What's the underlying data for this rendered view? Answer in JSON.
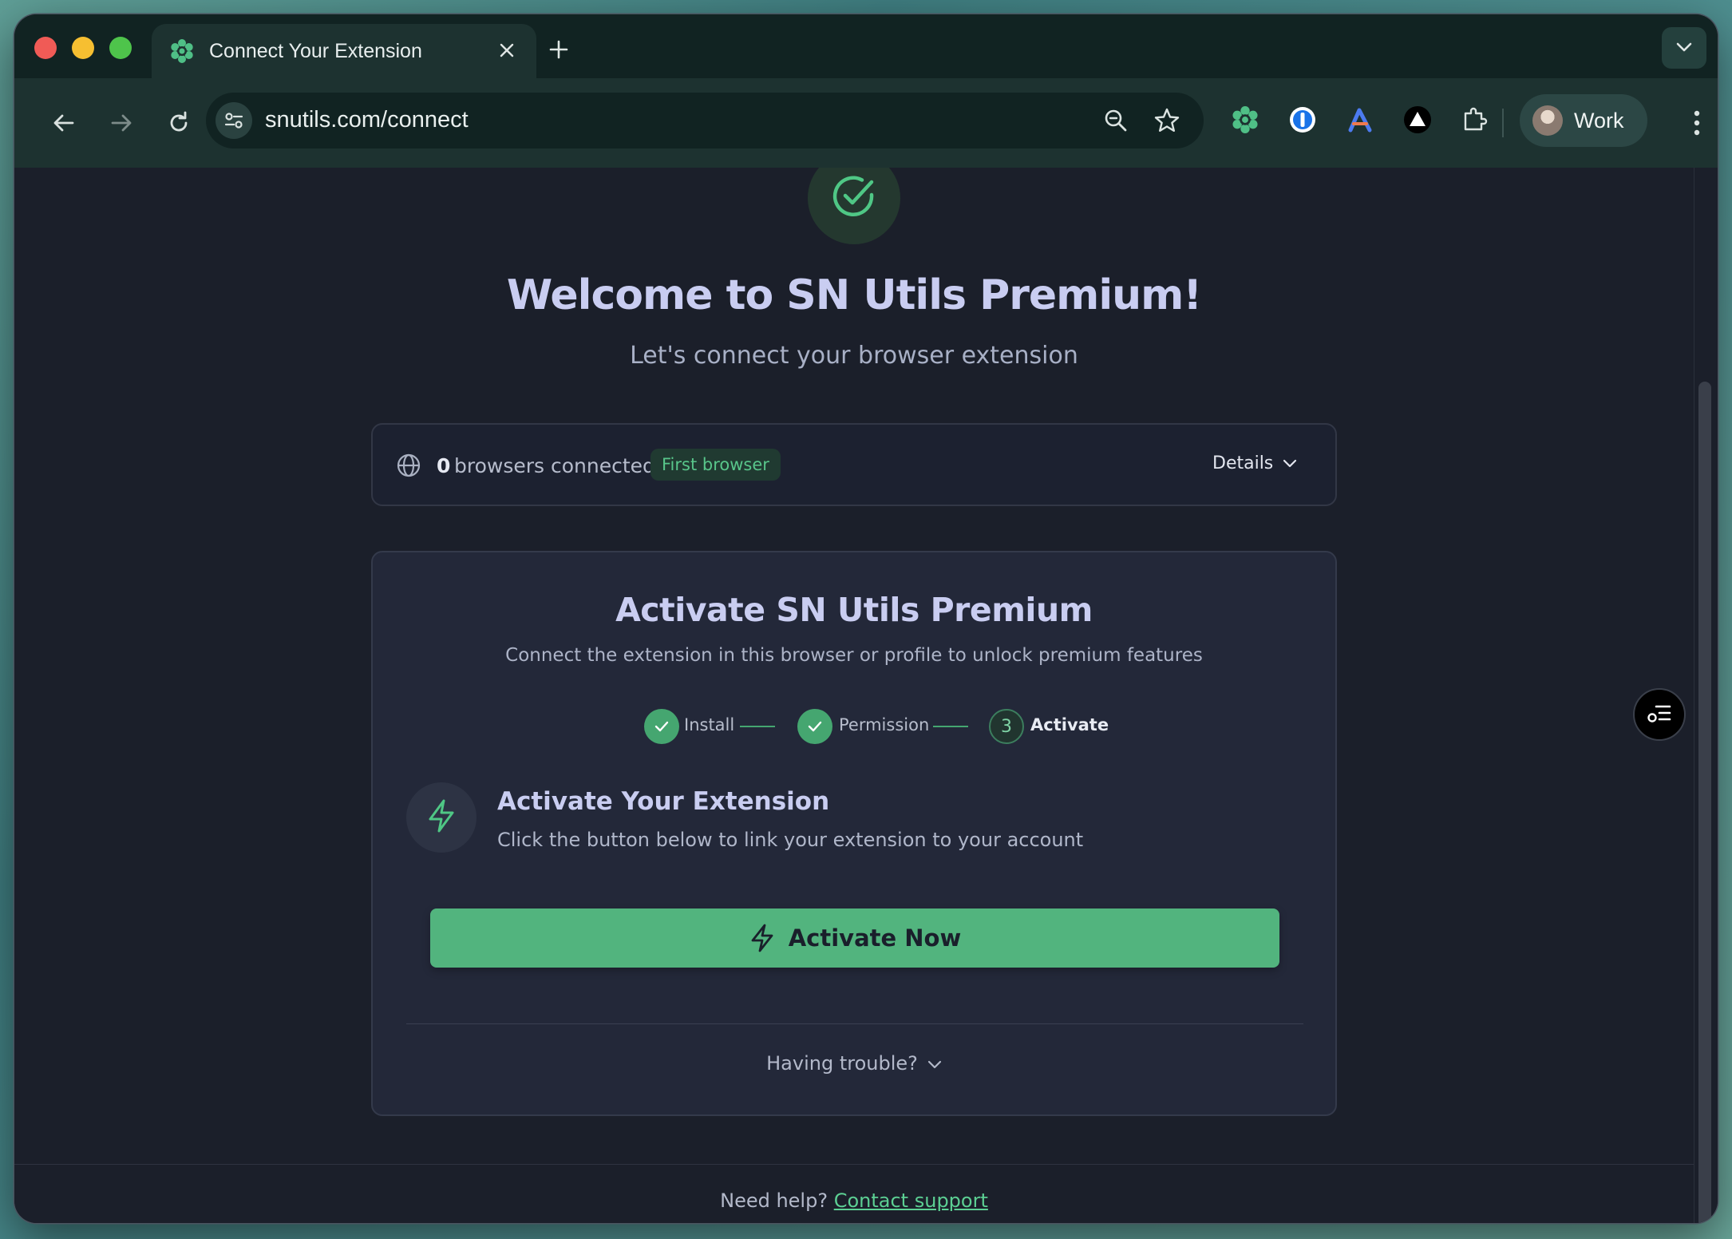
{
  "browser": {
    "tab": {
      "title": "Connect Your Extension",
      "favicon": "gear-flower-icon"
    },
    "url": "snutils.com/connect",
    "profile": {
      "name": "Work"
    },
    "toolbar_icons": [
      "back-arrow-icon",
      "forward-arrow-icon",
      "reload-icon",
      "site-settings-icon",
      "zoom-icon",
      "bookmark-star-icon",
      "sn-utils-extension-icon",
      "onepassword-icon",
      "arc-a-icon",
      "vercel-triangle-icon",
      "extensions-puzzle-icon",
      "kebab-menu-icon"
    ]
  },
  "hero": {
    "title": "Welcome to SN Utils Premium!",
    "subtitle": "Let's connect your browser extension"
  },
  "browsers": {
    "count": "0",
    "label": "browsers connected",
    "badge": "First browser",
    "details_label": "Details"
  },
  "activate_card": {
    "title": "Activate SN Utils Premium",
    "subtitle": "Connect the extension in this browser or profile to unlock premium features",
    "steps": [
      {
        "label": "Install",
        "state": "done"
      },
      {
        "label": "Permission",
        "state": "done"
      },
      {
        "label": "Activate",
        "state": "current",
        "number": "3"
      }
    ],
    "section_title": "Activate Your Extension",
    "section_desc": "Click the button below to link your extension to your account",
    "button_label": "Activate Now",
    "trouble_label": "Having trouble?"
  },
  "footer": {
    "text": "Need help?",
    "link": "Contact support"
  },
  "colors": {
    "accent": "#52b47e",
    "page_bg": "#1b1f2a",
    "card_bg": "#232839",
    "title": "#c9cdf1"
  }
}
